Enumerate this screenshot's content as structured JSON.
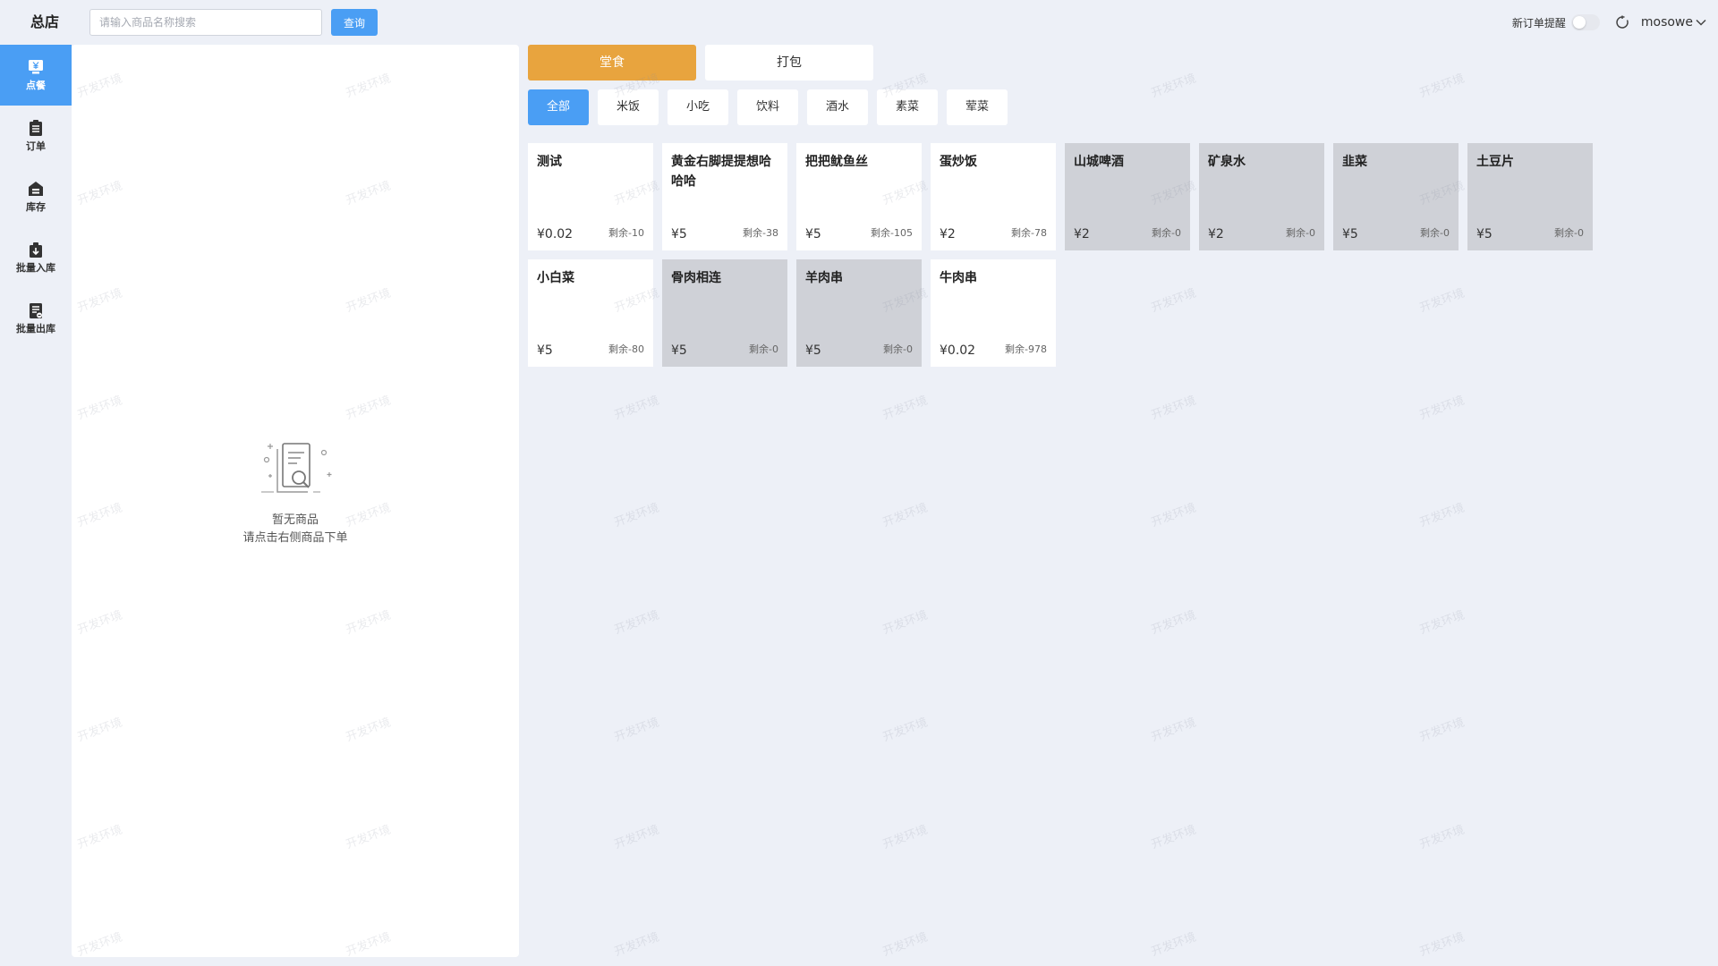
{
  "header": {
    "store_name": "总店",
    "search_placeholder": "请输入商品名称搜索",
    "search_value": "",
    "search_button": "查询",
    "notify_label": "新订单提醒",
    "notify_enabled": false,
    "username": "mosowe"
  },
  "sidebar": {
    "items": [
      {
        "label": "点餐",
        "icon": "yen-monitor-icon",
        "active": true
      },
      {
        "label": "订单",
        "icon": "clipboard-icon",
        "active": false
      },
      {
        "label": "库存",
        "icon": "warehouse-icon",
        "active": false
      },
      {
        "label": "批量入库",
        "icon": "box-in-icon",
        "active": false
      },
      {
        "label": "批量出库",
        "icon": "document-out-icon",
        "active": false
      }
    ]
  },
  "cart": {
    "empty_title": "暂无商品",
    "empty_hint": "请点击右侧商品下单"
  },
  "modes": [
    {
      "label": "堂食",
      "active": true
    },
    {
      "label": "打包",
      "active": false
    }
  ],
  "categories": [
    {
      "label": "全部",
      "active": true
    },
    {
      "label": "米饭",
      "active": false
    },
    {
      "label": "小吃",
      "active": false
    },
    {
      "label": "饮料",
      "active": false
    },
    {
      "label": "酒水",
      "active": false
    },
    {
      "label": "素菜",
      "active": false
    },
    {
      "label": "荤菜",
      "active": false
    }
  ],
  "products": [
    {
      "name": "测试",
      "price": "¥0.02",
      "stock": "剩余-10",
      "sold_out": false
    },
    {
      "name": "黄金右脚提提想哈哈哈",
      "price": "¥5",
      "stock": "剩余-38",
      "sold_out": false
    },
    {
      "name": "把把鱿鱼丝",
      "price": "¥5",
      "stock": "剩余-105",
      "sold_out": false
    },
    {
      "name": "蛋炒饭",
      "price": "¥2",
      "stock": "剩余-78",
      "sold_out": false
    },
    {
      "name": "山城啤酒",
      "price": "¥2",
      "stock": "剩余-0",
      "sold_out": true
    },
    {
      "name": "矿泉水",
      "price": "¥2",
      "stock": "剩余-0",
      "sold_out": true
    },
    {
      "name": "韭菜",
      "price": "¥5",
      "stock": "剩余-0",
      "sold_out": true
    },
    {
      "name": "土豆片",
      "price": "¥5",
      "stock": "剩余-0",
      "sold_out": true
    },
    {
      "name": "小白菜",
      "price": "¥5",
      "stock": "剩余-80",
      "sold_out": false
    },
    {
      "name": "骨肉相连",
      "price": "¥5",
      "stock": "剩余-0",
      "sold_out": true
    },
    {
      "name": "羊肉串",
      "price": "¥5",
      "stock": "剩余-0",
      "sold_out": true
    },
    {
      "name": "牛肉串",
      "price": "¥0.02",
      "stock": "剩余-978",
      "sold_out": false
    }
  ],
  "watermark_text": "开发环境",
  "colors": {
    "primary": "#4a9ef4",
    "mode_active": "#e8a43e",
    "sold_out_bg": "#cfd1d7",
    "page_bg": "#edf0f7"
  }
}
